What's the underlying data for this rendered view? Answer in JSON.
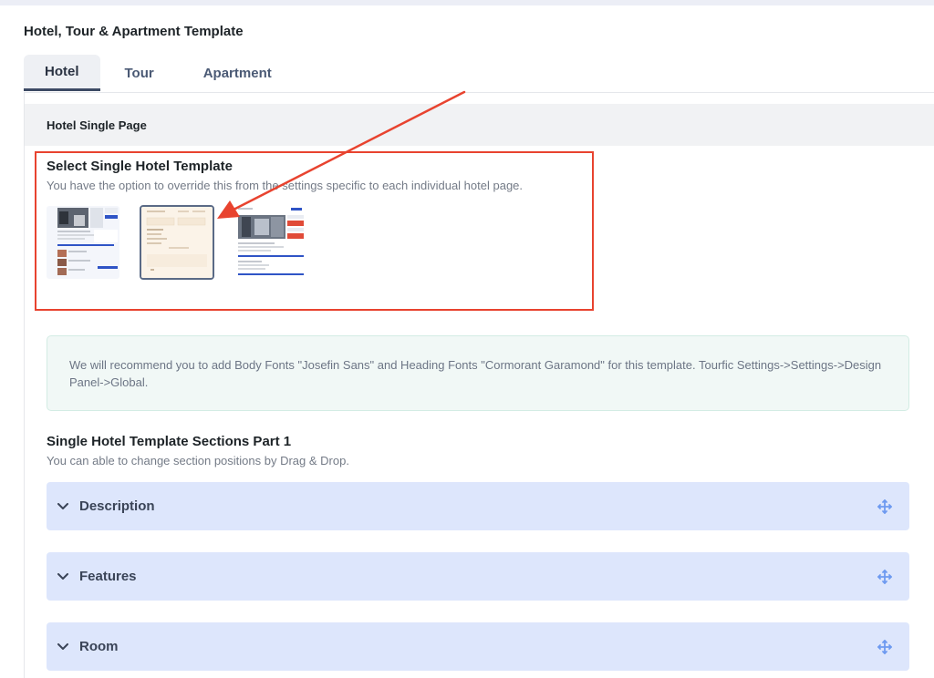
{
  "page": {
    "title": "Hotel, Tour & Apartment Template"
  },
  "tabs": [
    {
      "label": "Hotel",
      "active": true
    },
    {
      "label": "Tour",
      "active": false
    },
    {
      "label": "Apartment",
      "active": false
    }
  ],
  "hotel_single": {
    "header": "Hotel Single Page",
    "template_title": "Select Single Hotel Template",
    "template_desc": "You have the option to override this from the settings specific to each individual hotel page.",
    "selected_template_index": 1,
    "notice": "We will recommend you to add Body Fonts \"Josefin Sans\" and Heading Fonts \"Cormorant Garamond\" for this template. Tourfic Settings->Settings->Design Panel->Global.",
    "sections_title": "Single Hotel Template Sections Part 1",
    "sections_desc": "You can able to change section positions by Drag & Drop.",
    "sections": [
      {
        "label": "Description"
      },
      {
        "label": "Features"
      },
      {
        "label": "Room"
      }
    ]
  },
  "annotation_color": "#e8432f",
  "icons": {
    "collapse": "chevron-down-icon",
    "drag": "move-icon"
  }
}
